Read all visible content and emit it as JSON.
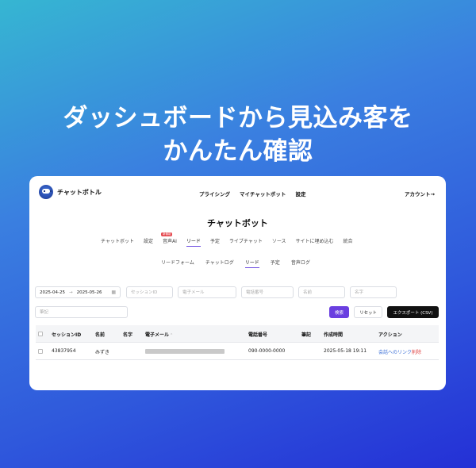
{
  "headline": {
    "line1": "ダッシュボードから見込み客を",
    "line2": "かんたん確認"
  },
  "app": {
    "brand": "チャットボトル",
    "nav": [
      "プライシング",
      "マイチャットボット",
      "設定"
    ],
    "account": "アカウント→"
  },
  "page": {
    "title": "チャットボット"
  },
  "tabs": {
    "items": [
      {
        "label": "チャットボット"
      },
      {
        "label": "設定"
      },
      {
        "label": "音声AI",
        "badge": "新機能"
      },
      {
        "label": "リード",
        "active": true
      },
      {
        "label": "予定"
      },
      {
        "label": "ライブチャット"
      },
      {
        "label": "ソース"
      },
      {
        "label": "サイトに埋め込む"
      },
      {
        "label": "統合"
      }
    ]
  },
  "subtabs": {
    "items": [
      {
        "label": "リードフォーム"
      },
      {
        "label": "チャットログ"
      },
      {
        "label": "リード",
        "active": true
      },
      {
        "label": "予定"
      },
      {
        "label": "音声ログ"
      }
    ]
  },
  "filters": {
    "date_from": "2025-04-25",
    "date_sep": "→",
    "date_to": "2025-05-26",
    "session_id_placeholder": "セッションID",
    "email_placeholder": "電子メール",
    "phone_placeholder": "電話番号",
    "name_placeholder": "名前",
    "lastname_placeholder": "名字",
    "memo_placeholder": "筆記"
  },
  "buttons": {
    "search": "検索",
    "reset": "リセット",
    "export": "エクスポート (CSV)"
  },
  "table": {
    "headers": {
      "session_id": "セッションID",
      "name": "名前",
      "lastname": "名字",
      "email": "電子メール",
      "phone": "電話番号",
      "memo": "筆記",
      "created": "作成時間",
      "action": "アクション"
    },
    "rows": [
      {
        "session_id": "43837954",
        "name": "みずき",
        "lastname": "",
        "phone": "090-0000-0000",
        "memo": "",
        "created": "2025-05-18 19:11",
        "action_link": "会話へのリンク",
        "action_delete": "削除"
      }
    ]
  }
}
